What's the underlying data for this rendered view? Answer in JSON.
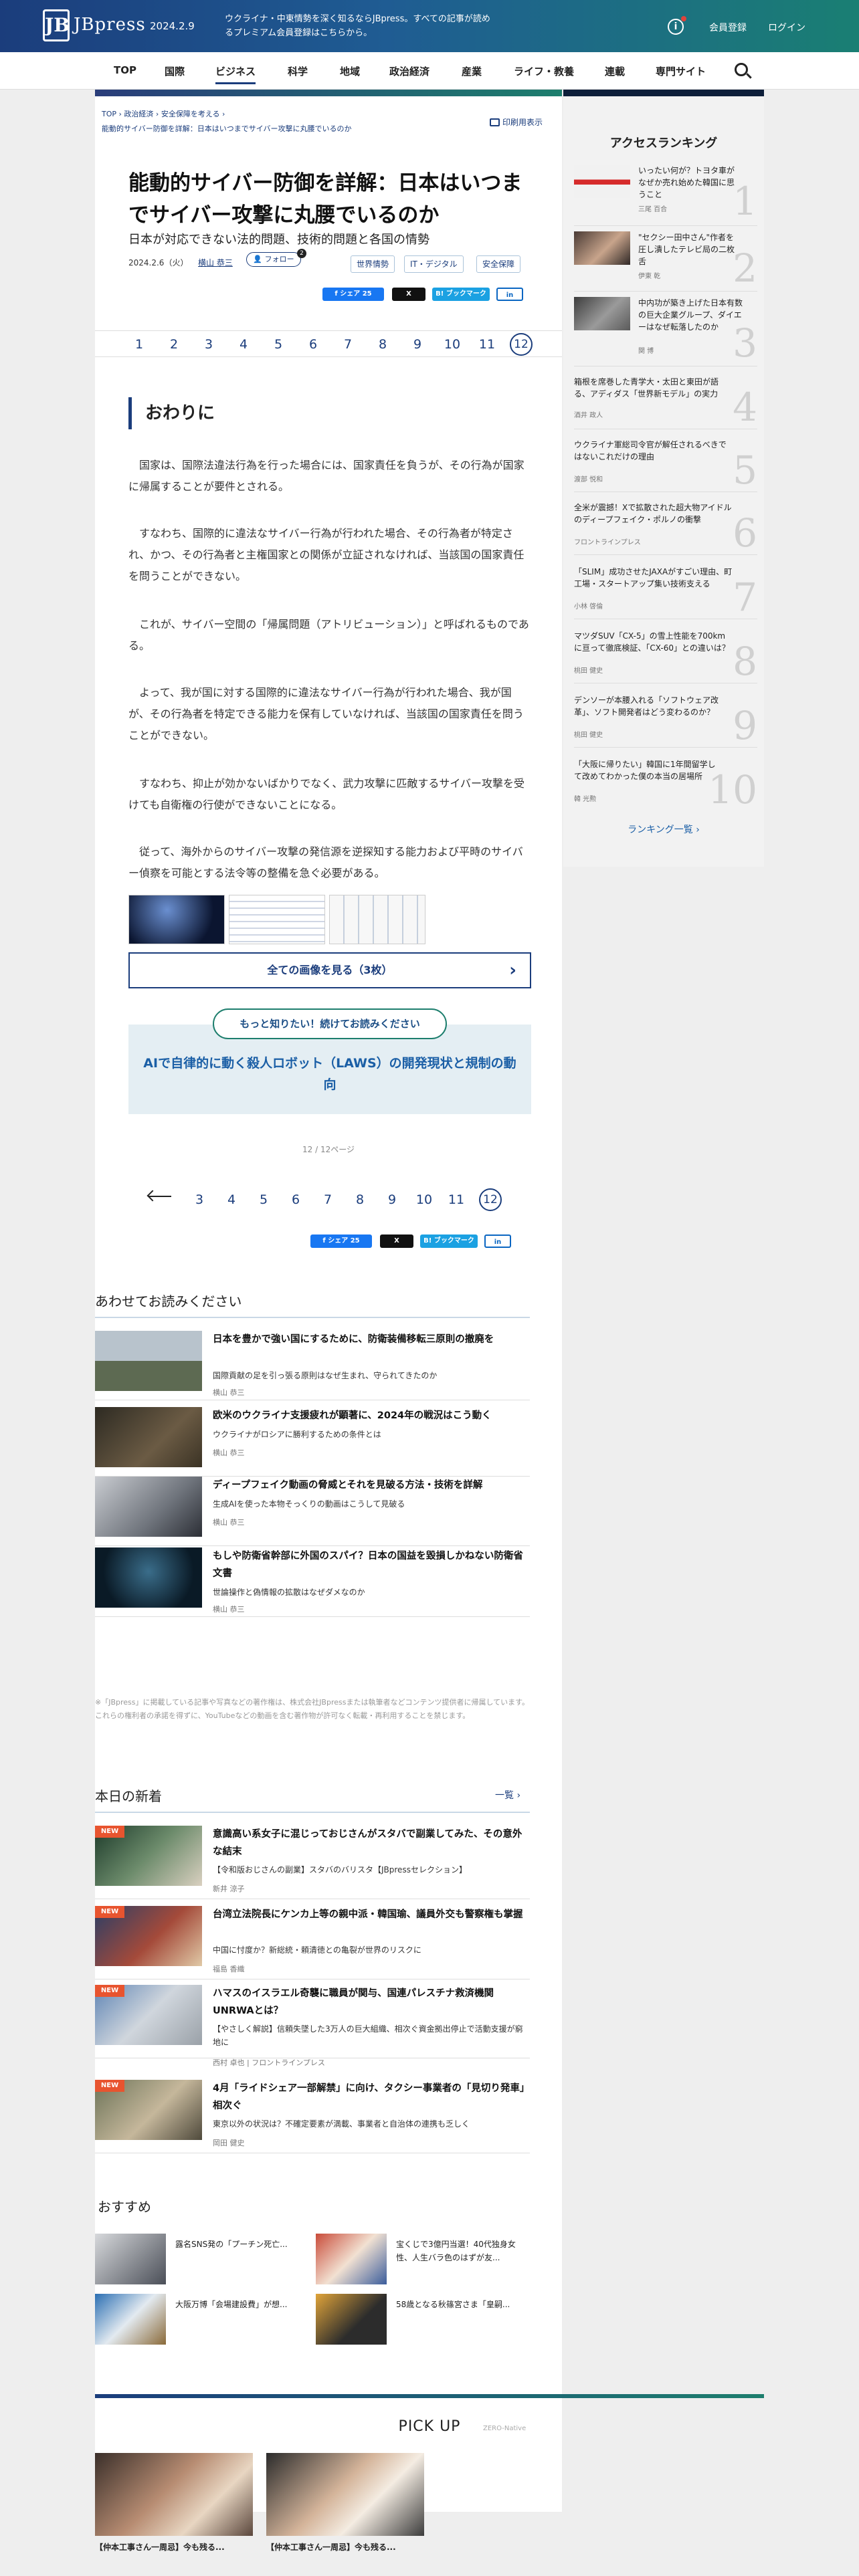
{
  "header": {
    "logo_mark": "JB",
    "logo_text": "JBpress",
    "date": "2024.2.9",
    "tagline": "ウクライナ・中東情勢を深く知るならJBpress。すべての記事が読めるプレミアム会員登録はこちらから。",
    "info_icon": "info-icon",
    "register": "会員登録",
    "login": "ログイン"
  },
  "nav": {
    "items": [
      "TOP",
      "国際",
      "ビジネス",
      "科学",
      "地域",
      "政治経済",
      "産業",
      "ライフ・教養",
      "連載",
      "専門サイト"
    ],
    "active": "ビジネス",
    "search_icon": "search-icon"
  },
  "breadcrumb": {
    "items": [
      "TOP",
      "政治経済",
      "安全保障を考える"
    ],
    "current": "能動的サイバー防御を詳解：日本はいつまでサイバー攻撃に丸腰でいるのか"
  },
  "print_label": "印刷用表示",
  "article": {
    "title": "能動的サイバー防御を詳解：日本はいつまでサイバー攻撃に丸腰でいるのか",
    "subtitle": "日本が対応できない法的問題、技術的問題と各国の情勢",
    "date": "2024.2.6（火）",
    "author": "横山 恭三",
    "follow_label": "フォロー",
    "follow_count": "2",
    "tags": [
      "世界情勢",
      "IT・デジタル",
      "安全保障"
    ],
    "share": {
      "fb": "シェア",
      "fb_count": "25",
      "x": "X",
      "hatena": "ブックマーク",
      "linkedin": "in"
    },
    "pages_top": [
      "1",
      "2",
      "3",
      "4",
      "5",
      "6",
      "7",
      "8",
      "9",
      "10",
      "11",
      "12"
    ],
    "pages_bottom": [
      "3",
      "4",
      "5",
      "6",
      "7",
      "8",
      "9",
      "10",
      "11",
      "12"
    ],
    "current_page": "12",
    "section_heading": "おわりに",
    "paragraphs": [
      "国家は、国際法違法行為を行った場合には、国家責任を負うが、その行為が国家に帰属することが要件とされる。",
      "すなわち、国際的に違法なサイバー行為が行われた場合、その行為者が特定され、かつ、その行為者と主権国家との関係が立証されなければ、当該国の国家責任を問うことができない。",
      "これが、サイバー空間の「帰属問題（アトリビューション）」と呼ばれるものである。",
      "よって、我が国に対する国際的に違法なサイバー行為が行われた場合、我が国が、その行為者を特定できる能力を保有していなければ、当該国の国家責任を問うことができない。",
      "すなわち、抑止が効かないばかりでなく、武力攻撃に匹敵するサイバー攻撃を受けても自衛権の行使ができないことになる。",
      "従って、海外からのサイバー攻撃の発信源を逆探知する能力および平時のサイバー偵察を可能とする法令等の整備を急ぐ必要がある。"
    ],
    "gallery_label": "全ての画像を見る（3枚）",
    "more_pill": "もっと知りたい！続けてお読みください",
    "more_link": "AIで自律的に動く殺人ロボット（LAWS）の開発現状と規制の動向",
    "page_count": "12 / 12ページ"
  },
  "related": {
    "heading": "あわせてお読みください",
    "items": [
      {
        "title": "日本を豊かで強い国にするために、防衛装備移転三原則の撤廃を",
        "sub": "国際貢献の足を引っ張る原則はなぜ生まれ、守られてきたのか",
        "author": "横山 恭三"
      },
      {
        "title": "欧米のウクライナ支援疲れが顕著に、2024年の戦況はこう動く",
        "sub": "ウクライナがロシアに勝利するための条件とは",
        "author": "横山 恭三"
      },
      {
        "title": "ディープフェイク動画の脅威とそれを見破る方法・技術を詳解",
        "sub": "生成AIを使った本物そっくりの動画はこうして見破る",
        "author": "横山 恭三"
      },
      {
        "title": "もしや防衛省幹部に外国のスパイ？日本の国益を毀損しかねない防衛省文書",
        "sub": "世論操作と偽情報の拡散はなぜダメなのか",
        "author": "横山 恭三"
      }
    ]
  },
  "notice": "※「JBpress」に掲載している記事や写真などの著作権は、株式会社JBpressまたは執筆者などコンテンツ提供者に帰属しています。これらの権利者の承諾を得ずに、YouTubeなどの動画を含む著作物が許可なく転載・再利用することを禁じます。",
  "news": {
    "heading": "本日の新着",
    "more": "一覧 ›",
    "badge": "NEW",
    "items": [
      {
        "title": "意識高い系女子に混じっておじさんがスタバで副業してみた、その意外な結末",
        "sub": "【令和版おじさんの副業】スタバのバリスタ【JBpressセレクション】",
        "author": "新井 涼子"
      },
      {
        "title": "台湾立法院長にケンカ上等の親中派・韓国瑜、議員外交も警察権も掌握",
        "sub": "中国に忖度か？新総統・頼清徳との亀裂が世界のリスクに",
        "author": "福島 香織"
      },
      {
        "title": "ハマスのイスラエル奇襲に職員が関与、国連パレスチナ救済機関UNRWAとは？",
        "sub": "【やさしく解説】信頼失墜した3万人の巨大組織、相次ぐ資金拠出停止で活動支援が窮地に",
        "author": "西村 卓也 | フロントラインプレス"
      },
      {
        "title": "4月「ライドシェア一部解禁」に向け、タクシー事業者の「見切り発車」相次ぐ",
        "sub": "東京以外の状況は？不確定要素が満載、事業者と自治体の連携も乏しく",
        "author": "岡田 健史"
      }
    ]
  },
  "recommend": {
    "heading": "おすすめ",
    "items": [
      "露名SNS発の「プーチン死亡...",
      "宝くじで3億円当選！40代独身女性、人生バラ色のはずが友...",
      "大阪万博「会場建設費」が想...",
      "58歳となる秋篠宮さま「皇嗣..."
    ]
  },
  "ranking": {
    "heading": "アクセスランキング",
    "more": "ランキング一覧 ›",
    "items": [
      {
        "rank": "1",
        "title": "いったい何が？トヨタ車がなぜか売れ始めた韓国に思うこと",
        "author": "三尾 百合"
      },
      {
        "rank": "2",
        "title": "\"セクシー田中さん\"作者を圧し潰したテレビ局の二枚舌",
        "author": "伊東 乾"
      },
      {
        "rank": "3",
        "title": "中内功が築き上げた日本有数の巨大企業グループ、ダイエーはなぜ転落したのか",
        "author": "関 博"
      },
      {
        "rank": "4",
        "title": "箱根を席巻した青学大・太田と東田が語る、アディダス「世界新モデル」の実力",
        "author": "酒井 政人"
      },
      {
        "rank": "5",
        "title": "ウクライナ軍総司令官が解任されるべきではないこれだけの理由",
        "author": "渡部 悦和"
      },
      {
        "rank": "6",
        "title": "全米が震撼！Xで拡散された超大物アイドルのディープフェイク・ポルノの衝撃",
        "author": "フロントラインプレス"
      },
      {
        "rank": "7",
        "title": "「SLIM」成功させたJAXAがすごい理由、町工場・スタートアップ集い技術支える",
        "author": "小林 啓倫"
      },
      {
        "rank": "8",
        "title": "マツダSUV「CX-5」の雪上性能を700kmに亘って徹底検証、「CX-60」との違いは？",
        "author": "桃田 健史"
      },
      {
        "rank": "9",
        "title": "デンソーが本腰入れる「ソフトウェア改革」、ソフト開発者はどう変わるのか？",
        "author": "桃田 健史"
      },
      {
        "rank": "10",
        "title": "「大阪に帰りたい」韓国に1年間留学して改めてわかった僕の本当の居場所",
        "author": "韓 光勲"
      }
    ]
  },
  "pickup": {
    "heading": "PICK UP",
    "label": "ZERO-Native",
    "items": [
      "【仲本工事さん一周忌】今も残る...",
      "【仲本工事さん一周忌】今も残る..."
    ]
  },
  "colors": {
    "brand_navy": "#1b3d7c",
    "brand_teal": "#1d7e6d",
    "new_badge": "#e8542f"
  }
}
